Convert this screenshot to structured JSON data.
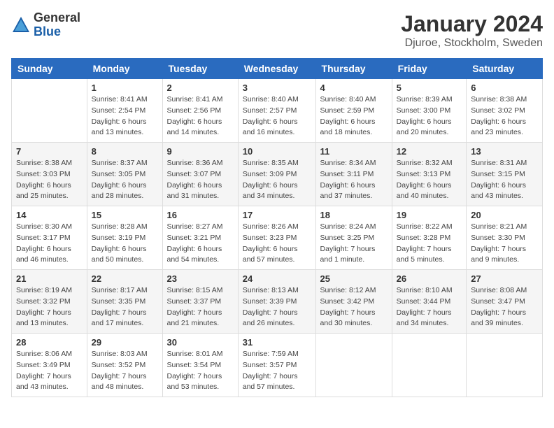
{
  "header": {
    "logo_general": "General",
    "logo_blue": "Blue",
    "month_title": "January 2024",
    "location": "Djuroe, Stockholm, Sweden"
  },
  "weekdays": [
    "Sunday",
    "Monday",
    "Tuesday",
    "Wednesday",
    "Thursday",
    "Friday",
    "Saturday"
  ],
  "weeks": [
    [
      {
        "day": "",
        "sunrise": "",
        "sunset": "",
        "daylight": ""
      },
      {
        "day": "1",
        "sunrise": "Sunrise: 8:41 AM",
        "sunset": "Sunset: 2:54 PM",
        "daylight": "Daylight: 6 hours and 13 minutes."
      },
      {
        "day": "2",
        "sunrise": "Sunrise: 8:41 AM",
        "sunset": "Sunset: 2:56 PM",
        "daylight": "Daylight: 6 hours and 14 minutes."
      },
      {
        "day": "3",
        "sunrise": "Sunrise: 8:40 AM",
        "sunset": "Sunset: 2:57 PM",
        "daylight": "Daylight: 6 hours and 16 minutes."
      },
      {
        "day": "4",
        "sunrise": "Sunrise: 8:40 AM",
        "sunset": "Sunset: 2:59 PM",
        "daylight": "Daylight: 6 hours and 18 minutes."
      },
      {
        "day": "5",
        "sunrise": "Sunrise: 8:39 AM",
        "sunset": "Sunset: 3:00 PM",
        "daylight": "Daylight: 6 hours and 20 minutes."
      },
      {
        "day": "6",
        "sunrise": "Sunrise: 8:38 AM",
        "sunset": "Sunset: 3:02 PM",
        "daylight": "Daylight: 6 hours and 23 minutes."
      }
    ],
    [
      {
        "day": "7",
        "sunrise": "Sunrise: 8:38 AM",
        "sunset": "Sunset: 3:03 PM",
        "daylight": "Daylight: 6 hours and 25 minutes."
      },
      {
        "day": "8",
        "sunrise": "Sunrise: 8:37 AM",
        "sunset": "Sunset: 3:05 PM",
        "daylight": "Daylight: 6 hours and 28 minutes."
      },
      {
        "day": "9",
        "sunrise": "Sunrise: 8:36 AM",
        "sunset": "Sunset: 3:07 PM",
        "daylight": "Daylight: 6 hours and 31 minutes."
      },
      {
        "day": "10",
        "sunrise": "Sunrise: 8:35 AM",
        "sunset": "Sunset: 3:09 PM",
        "daylight": "Daylight: 6 hours and 34 minutes."
      },
      {
        "day": "11",
        "sunrise": "Sunrise: 8:34 AM",
        "sunset": "Sunset: 3:11 PM",
        "daylight": "Daylight: 6 hours and 37 minutes."
      },
      {
        "day": "12",
        "sunrise": "Sunrise: 8:32 AM",
        "sunset": "Sunset: 3:13 PM",
        "daylight": "Daylight: 6 hours and 40 minutes."
      },
      {
        "day": "13",
        "sunrise": "Sunrise: 8:31 AM",
        "sunset": "Sunset: 3:15 PM",
        "daylight": "Daylight: 6 hours and 43 minutes."
      }
    ],
    [
      {
        "day": "14",
        "sunrise": "Sunrise: 8:30 AM",
        "sunset": "Sunset: 3:17 PM",
        "daylight": "Daylight: 6 hours and 46 minutes."
      },
      {
        "day": "15",
        "sunrise": "Sunrise: 8:28 AM",
        "sunset": "Sunset: 3:19 PM",
        "daylight": "Daylight: 6 hours and 50 minutes."
      },
      {
        "day": "16",
        "sunrise": "Sunrise: 8:27 AM",
        "sunset": "Sunset: 3:21 PM",
        "daylight": "Daylight: 6 hours and 54 minutes."
      },
      {
        "day": "17",
        "sunrise": "Sunrise: 8:26 AM",
        "sunset": "Sunset: 3:23 PM",
        "daylight": "Daylight: 6 hours and 57 minutes."
      },
      {
        "day": "18",
        "sunrise": "Sunrise: 8:24 AM",
        "sunset": "Sunset: 3:25 PM",
        "daylight": "Daylight: 7 hours and 1 minute."
      },
      {
        "day": "19",
        "sunrise": "Sunrise: 8:22 AM",
        "sunset": "Sunset: 3:28 PM",
        "daylight": "Daylight: 7 hours and 5 minutes."
      },
      {
        "day": "20",
        "sunrise": "Sunrise: 8:21 AM",
        "sunset": "Sunset: 3:30 PM",
        "daylight": "Daylight: 7 hours and 9 minutes."
      }
    ],
    [
      {
        "day": "21",
        "sunrise": "Sunrise: 8:19 AM",
        "sunset": "Sunset: 3:32 PM",
        "daylight": "Daylight: 7 hours and 13 minutes."
      },
      {
        "day": "22",
        "sunrise": "Sunrise: 8:17 AM",
        "sunset": "Sunset: 3:35 PM",
        "daylight": "Daylight: 7 hours and 17 minutes."
      },
      {
        "day": "23",
        "sunrise": "Sunrise: 8:15 AM",
        "sunset": "Sunset: 3:37 PM",
        "daylight": "Daylight: 7 hours and 21 minutes."
      },
      {
        "day": "24",
        "sunrise": "Sunrise: 8:13 AM",
        "sunset": "Sunset: 3:39 PM",
        "daylight": "Daylight: 7 hours and 26 minutes."
      },
      {
        "day": "25",
        "sunrise": "Sunrise: 8:12 AM",
        "sunset": "Sunset: 3:42 PM",
        "daylight": "Daylight: 7 hours and 30 minutes."
      },
      {
        "day": "26",
        "sunrise": "Sunrise: 8:10 AM",
        "sunset": "Sunset: 3:44 PM",
        "daylight": "Daylight: 7 hours and 34 minutes."
      },
      {
        "day": "27",
        "sunrise": "Sunrise: 8:08 AM",
        "sunset": "Sunset: 3:47 PM",
        "daylight": "Daylight: 7 hours and 39 minutes."
      }
    ],
    [
      {
        "day": "28",
        "sunrise": "Sunrise: 8:06 AM",
        "sunset": "Sunset: 3:49 PM",
        "daylight": "Daylight: 7 hours and 43 minutes."
      },
      {
        "day": "29",
        "sunrise": "Sunrise: 8:03 AM",
        "sunset": "Sunset: 3:52 PM",
        "daylight": "Daylight: 7 hours and 48 minutes."
      },
      {
        "day": "30",
        "sunrise": "Sunrise: 8:01 AM",
        "sunset": "Sunset: 3:54 PM",
        "daylight": "Daylight: 7 hours and 53 minutes."
      },
      {
        "day": "31",
        "sunrise": "Sunrise: 7:59 AM",
        "sunset": "Sunset: 3:57 PM",
        "daylight": "Daylight: 7 hours and 57 minutes."
      },
      {
        "day": "",
        "sunrise": "",
        "sunset": "",
        "daylight": ""
      },
      {
        "day": "",
        "sunrise": "",
        "sunset": "",
        "daylight": ""
      },
      {
        "day": "",
        "sunrise": "",
        "sunset": "",
        "daylight": ""
      }
    ]
  ]
}
